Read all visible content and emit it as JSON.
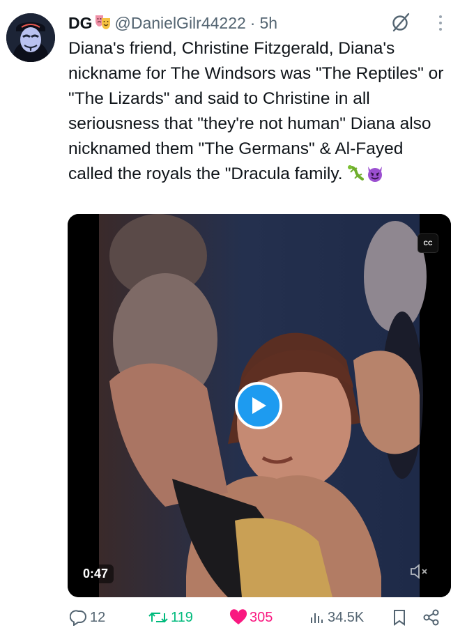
{
  "tweet": {
    "display_name": "DG",
    "handle": "@DanielGilr44222",
    "separator": "·",
    "time": "5h",
    "text": "Diana's friend, Christine Fitzgerald, Diana's nickname for The Windsors was \"The Reptiles\" or \"The Lizards\" and said to Christine in all seriousness that \"they're not human\" Diana also nicknamed them \"The Germans\" & Al-Fayed called the royals the \"Dracula family.",
    "name_emoji": "theater-masks-icon",
    "trailing_emojis": [
      "lizard-icon",
      "smiling-devil-icon"
    ]
  },
  "video": {
    "cc_label": "CC",
    "duration": "0:47",
    "muted": true
  },
  "actions": {
    "replies": "12",
    "reposts": "119",
    "likes": "305",
    "views": "34.5K"
  },
  "colors": {
    "accent": "#1d9bf0",
    "repost": "#00ba7c",
    "like": "#f91880",
    "muted_text": "#536471"
  }
}
